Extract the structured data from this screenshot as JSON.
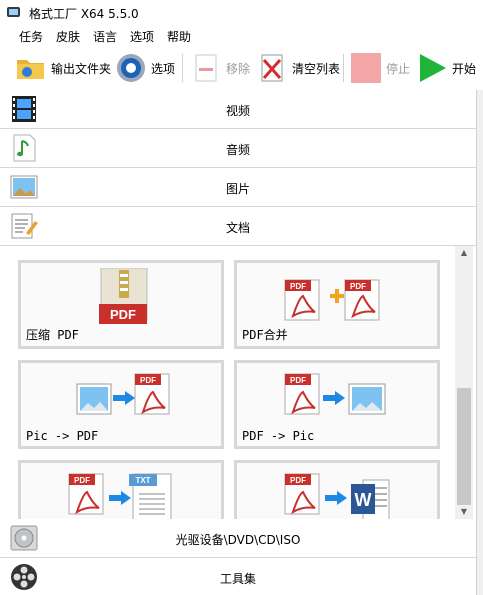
{
  "window": {
    "title": "格式工厂 X64 5.5.0"
  },
  "menu": [
    "任务",
    "皮肤",
    "语言",
    "选项",
    "帮助"
  ],
  "toolbar": {
    "output_folder": "输出文件夹",
    "options": "选项",
    "remove": "移除",
    "clear_list": "清空列表",
    "stop": "停止",
    "start": "开始"
  },
  "categories": {
    "video": "视频",
    "audio": "音频",
    "picture": "图片",
    "document": "文档",
    "rom": "光驱设备\\DVD\\CD\\ISO",
    "tools": "工具集"
  },
  "tiles": [
    "压缩 PDF",
    "PDF合并",
    "Pic -> PDF",
    "PDF -> Pic"
  ],
  "icon_text": {
    "pdf": "PDF",
    "txt": "TXT",
    "word": "W"
  },
  "colors": {
    "pdf_red": "#c9302c",
    "accent_blue": "#1e88e5",
    "start_green": "#1fb53a",
    "stop_pink": "#f4a6a6"
  }
}
